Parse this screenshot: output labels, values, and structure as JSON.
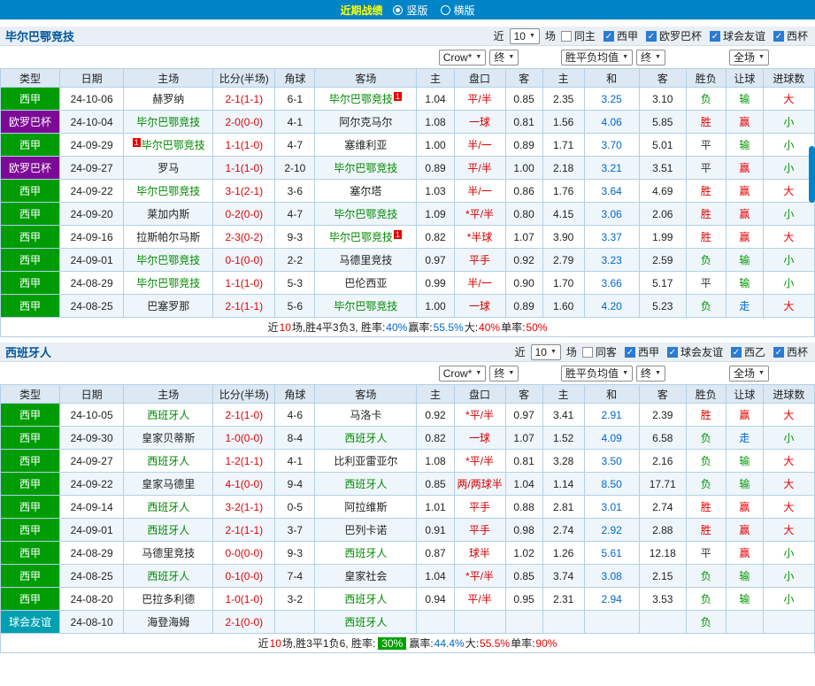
{
  "topbar": {
    "title": "近期战绩",
    "radios": [
      {
        "label": "竖版",
        "selected": true
      },
      {
        "label": "横版",
        "selected": false
      }
    ]
  },
  "sections": [
    {
      "team": "毕尔巴鄂竞技",
      "filter": {
        "near": "近",
        "count": "10",
        "unit": "场",
        "checkboxes": [
          {
            "label": "同主",
            "checked": false
          },
          {
            "label": "西甲",
            "checked": true
          },
          {
            "label": "欧罗巴杯",
            "checked": true
          },
          {
            "label": "球会友谊",
            "checked": true
          },
          {
            "label": "西杯",
            "checked": true
          }
        ]
      },
      "selects": {
        "bookmaker": "Crow*",
        "bookmaker_stage": "终",
        "europe_avg": "胜平负均值",
        "europe_stage": "终",
        "scope": "全场"
      },
      "columns": [
        "类型",
        "日期",
        "主场",
        "比分(半场)",
        "角球",
        "客场",
        "主",
        "盘口",
        "客",
        "主",
        "和",
        "客",
        "胜负",
        "让球",
        "进球数"
      ],
      "rows": [
        {
          "league": "西甲",
          "date": "24-10-06",
          "home": {
            "name": "赫罗纳",
            "focus": false,
            "card": ""
          },
          "score": "2-1(1-1)",
          "corner": "6-1",
          "away": {
            "name": "毕尔巴鄂竞技",
            "focus": true,
            "card": "1"
          },
          "asia": {
            "h": "1.04",
            "line": "平/半",
            "a": "0.85"
          },
          "eu": {
            "h": "2.35",
            "d": "3.25",
            "a": "3.10"
          },
          "res": {
            "wdl": "负",
            "ah": "输",
            "ou": "大"
          }
        },
        {
          "league": "欧罗巴杯",
          "date": "24-10-04",
          "home": {
            "name": "毕尔巴鄂竞技",
            "focus": true,
            "card": ""
          },
          "score": "2-0(0-0)",
          "corner": "4-1",
          "away": {
            "name": "阿尔克马尔",
            "focus": false,
            "card": ""
          },
          "asia": {
            "h": "1.08",
            "line": "一球",
            "a": "0.81"
          },
          "eu": {
            "h": "1.56",
            "d": "4.06",
            "a": "5.85"
          },
          "res": {
            "wdl": "胜",
            "ah": "赢",
            "ou": "小"
          }
        },
        {
          "league": "西甲",
          "date": "24-09-29",
          "home": {
            "name": "毕尔巴鄂竞技",
            "focus": true,
            "card": "1"
          },
          "score": "1-1(1-0)",
          "corner": "4-7",
          "away": {
            "name": "塞维利亚",
            "focus": false,
            "card": ""
          },
          "asia": {
            "h": "1.00",
            "line": "半/一",
            "a": "0.89"
          },
          "eu": {
            "h": "1.71",
            "d": "3.70",
            "a": "5.01"
          },
          "res": {
            "wdl": "平",
            "ah": "输",
            "ou": "小"
          }
        },
        {
          "league": "欧罗巴杯",
          "date": "24-09-27",
          "home": {
            "name": "罗马",
            "focus": false,
            "card": ""
          },
          "score": "1-1(1-0)",
          "corner": "2-10",
          "away": {
            "name": "毕尔巴鄂竞技",
            "focus": true,
            "card": ""
          },
          "asia": {
            "h": "0.89",
            "line": "平/半",
            "a": "1.00"
          },
          "eu": {
            "h": "2.18",
            "d": "3.21",
            "a": "3.51"
          },
          "res": {
            "wdl": "平",
            "ah": "赢",
            "ou": "小"
          }
        },
        {
          "league": "西甲",
          "date": "24-09-22",
          "home": {
            "name": "毕尔巴鄂竞技",
            "focus": true,
            "card": ""
          },
          "score": "3-1(2-1)",
          "corner": "3-6",
          "away": {
            "name": "塞尔塔",
            "focus": false,
            "card": ""
          },
          "asia": {
            "h": "1.03",
            "line": "半/一",
            "a": "0.86"
          },
          "eu": {
            "h": "1.76",
            "d": "3.64",
            "a": "4.69"
          },
          "res": {
            "wdl": "胜",
            "ah": "赢",
            "ou": "大"
          }
        },
        {
          "league": "西甲",
          "date": "24-09-20",
          "home": {
            "name": "莱加内斯",
            "focus": false,
            "card": ""
          },
          "score": "0-2(0-0)",
          "corner": "4-7",
          "away": {
            "name": "毕尔巴鄂竞技",
            "focus": true,
            "card": ""
          },
          "asia": {
            "h": "1.09",
            "line": "*平/半",
            "a": "0.80"
          },
          "eu": {
            "h": "4.15",
            "d": "3.06",
            "a": "2.06"
          },
          "res": {
            "wdl": "胜",
            "ah": "赢",
            "ou": "小"
          }
        },
        {
          "league": "西甲",
          "date": "24-09-16",
          "home": {
            "name": "拉斯帕尔马斯",
            "focus": false,
            "card": ""
          },
          "score": "2-3(0-2)",
          "corner": "9-3",
          "away": {
            "name": "毕尔巴鄂竞技",
            "focus": true,
            "card": "1"
          },
          "asia": {
            "h": "0.82",
            "line": "*半球",
            "a": "1.07"
          },
          "eu": {
            "h": "3.90",
            "d": "3.37",
            "a": "1.99"
          },
          "res": {
            "wdl": "胜",
            "ah": "赢",
            "ou": "大"
          }
        },
        {
          "league": "西甲",
          "date": "24-09-01",
          "home": {
            "name": "毕尔巴鄂竞技",
            "focus": true,
            "card": ""
          },
          "score": "0-1(0-0)",
          "corner": "2-2",
          "away": {
            "name": "马德里竞技",
            "focus": false,
            "card": ""
          },
          "asia": {
            "h": "0.97",
            "line": "平手",
            "a": "0.92"
          },
          "eu": {
            "h": "2.79",
            "d": "3.23",
            "a": "2.59"
          },
          "res": {
            "wdl": "负",
            "ah": "输",
            "ou": "小"
          }
        },
        {
          "league": "西甲",
          "date": "24-08-29",
          "home": {
            "name": "毕尔巴鄂竞技",
            "focus": true,
            "card": ""
          },
          "score": "1-1(1-0)",
          "corner": "5-3",
          "away": {
            "name": "巴伦西亚",
            "focus": false,
            "card": ""
          },
          "asia": {
            "h": "0.99",
            "line": "半/一",
            "a": "0.90"
          },
          "eu": {
            "h": "1.70",
            "d": "3.66",
            "a": "5.17"
          },
          "res": {
            "wdl": "平",
            "ah": "输",
            "ou": "小"
          }
        },
        {
          "league": "西甲",
          "date": "24-08-25",
          "home": {
            "name": "巴塞罗那",
            "focus": false,
            "card": ""
          },
          "score": "2-1(1-1)",
          "corner": "5-6",
          "away": {
            "name": "毕尔巴鄂竞技",
            "focus": true,
            "card": ""
          },
          "asia": {
            "h": "1.00",
            "line": "一球",
            "a": "0.89"
          },
          "eu": {
            "h": "1.60",
            "d": "4.20",
            "a": "5.23"
          },
          "res": {
            "wdl": "负",
            "ah": "走",
            "ou": "大"
          }
        }
      ],
      "summary": [
        {
          "t": "近",
          "c": "k"
        },
        {
          "t": "10",
          "c": "r"
        },
        {
          "t": "场,胜4平3负3, 胜率:",
          "c": "k"
        },
        {
          "t": "40%",
          "c": "b"
        },
        {
          "t": " 赢率:",
          "c": "k"
        },
        {
          "t": "55.5%",
          "c": "b"
        },
        {
          "t": " 大:",
          "c": "k"
        },
        {
          "t": "40%",
          "c": "r"
        },
        {
          "t": " 单率:",
          "c": "k"
        },
        {
          "t": "50%",
          "c": "r"
        }
      ]
    },
    {
      "team": "西班牙人",
      "filter": {
        "near": "近",
        "count": "10",
        "unit": "场",
        "checkboxes": [
          {
            "label": "同客",
            "checked": false
          },
          {
            "label": "西甲",
            "checked": true
          },
          {
            "label": "球会友谊",
            "checked": true
          },
          {
            "label": "西乙",
            "checked": true
          },
          {
            "label": "西杯",
            "checked": true
          }
        ]
      },
      "selects": {
        "bookmaker": "Crow*",
        "bookmaker_stage": "终",
        "europe_avg": "胜平负均值",
        "europe_stage": "终",
        "scope": "全场"
      },
      "columns": [
        "类型",
        "日期",
        "主场",
        "比分(半场)",
        "角球",
        "客场",
        "主",
        "盘口",
        "客",
        "主",
        "和",
        "客",
        "胜负",
        "让球",
        "进球数"
      ],
      "rows": [
        {
          "league": "西甲",
          "date": "24-10-05",
          "home": {
            "name": "西班牙人",
            "focus": true,
            "card": ""
          },
          "score": "2-1(1-0)",
          "corner": "4-6",
          "away": {
            "name": "马洛卡",
            "focus": false,
            "card": ""
          },
          "asia": {
            "h": "0.92",
            "line": "*平/半",
            "a": "0.97"
          },
          "eu": {
            "h": "3.41",
            "d": "2.91",
            "a": "2.39"
          },
          "res": {
            "wdl": "胜",
            "ah": "赢",
            "ou": "大"
          }
        },
        {
          "league": "西甲",
          "date": "24-09-30",
          "home": {
            "name": "皇家贝蒂斯",
            "focus": false,
            "card": ""
          },
          "score": "1-0(0-0)",
          "corner": "8-4",
          "away": {
            "name": "西班牙人",
            "focus": true,
            "card": ""
          },
          "asia": {
            "h": "0.82",
            "line": "一球",
            "a": "1.07"
          },
          "eu": {
            "h": "1.52",
            "d": "4.09",
            "a": "6.58"
          },
          "res": {
            "wdl": "负",
            "ah": "走",
            "ou": "小"
          }
        },
        {
          "league": "西甲",
          "date": "24-09-27",
          "home": {
            "name": "西班牙人",
            "focus": true,
            "card": ""
          },
          "score": "1-2(1-1)",
          "corner": "4-1",
          "away": {
            "name": "比利亚雷亚尔",
            "focus": false,
            "card": ""
          },
          "asia": {
            "h": "1.08",
            "line": "*平/半",
            "a": "0.81"
          },
          "eu": {
            "h": "3.28",
            "d": "3.50",
            "a": "2.16"
          },
          "res": {
            "wdl": "负",
            "ah": "输",
            "ou": "大"
          }
        },
        {
          "league": "西甲",
          "date": "24-09-22",
          "home": {
            "name": "皇家马德里",
            "focus": false,
            "card": ""
          },
          "score": "4-1(0-0)",
          "corner": "9-4",
          "away": {
            "name": "西班牙人",
            "focus": true,
            "card": ""
          },
          "asia": {
            "h": "0.85",
            "line": "两/两球半",
            "a": "1.04"
          },
          "eu": {
            "h": "1.14",
            "d": "8.50",
            "a": "17.71"
          },
          "res": {
            "wdl": "负",
            "ah": "输",
            "ou": "大"
          }
        },
        {
          "league": "西甲",
          "date": "24-09-14",
          "home": {
            "name": "西班牙人",
            "focus": true,
            "card": ""
          },
          "score": "3-2(1-1)",
          "corner": "0-5",
          "away": {
            "name": "阿拉维斯",
            "focus": false,
            "card": ""
          },
          "asia": {
            "h": "1.01",
            "line": "平手",
            "a": "0.88"
          },
          "eu": {
            "h": "2.81",
            "d": "3.01",
            "a": "2.74"
          },
          "res": {
            "wdl": "胜",
            "ah": "赢",
            "ou": "大"
          }
        },
        {
          "league": "西甲",
          "date": "24-09-01",
          "home": {
            "name": "西班牙人",
            "focus": true,
            "card": ""
          },
          "score": "2-1(1-1)",
          "corner": "3-7",
          "away": {
            "name": "巴列卡诺",
            "focus": false,
            "card": ""
          },
          "asia": {
            "h": "0.91",
            "line": "平手",
            "a": "0.98"
          },
          "eu": {
            "h": "2.74",
            "d": "2.92",
            "a": "2.88"
          },
          "res": {
            "wdl": "胜",
            "ah": "赢",
            "ou": "大"
          }
        },
        {
          "league": "西甲",
          "date": "24-08-29",
          "home": {
            "name": "马德里竞技",
            "focus": false,
            "card": ""
          },
          "score": "0-0(0-0)",
          "corner": "9-3",
          "away": {
            "name": "西班牙人",
            "focus": true,
            "card": ""
          },
          "asia": {
            "h": "0.87",
            "line": "球半",
            "a": "1.02"
          },
          "eu": {
            "h": "1.26",
            "d": "5.61",
            "a": "12.18"
          },
          "res": {
            "wdl": "平",
            "ah": "赢",
            "ou": "小"
          }
        },
        {
          "league": "西甲",
          "date": "24-08-25",
          "home": {
            "name": "西班牙人",
            "focus": true,
            "card": ""
          },
          "score": "0-1(0-0)",
          "corner": "7-4",
          "away": {
            "name": "皇家社会",
            "focus": false,
            "card": ""
          },
          "asia": {
            "h": "1.04",
            "line": "*平/半",
            "a": "0.85"
          },
          "eu": {
            "h": "3.74",
            "d": "3.08",
            "a": "2.15"
          },
          "res": {
            "wdl": "负",
            "ah": "输",
            "ou": "小"
          }
        },
        {
          "league": "西甲",
          "date": "24-08-20",
          "home": {
            "name": "巴拉多利德",
            "focus": false,
            "card": ""
          },
          "score": "1-0(1-0)",
          "corner": "3-2",
          "away": {
            "name": "西班牙人",
            "focus": true,
            "card": ""
          },
          "asia": {
            "h": "0.94",
            "line": "平/半",
            "a": "0.95"
          },
          "eu": {
            "h": "2.31",
            "d": "2.94",
            "a": "3.53"
          },
          "res": {
            "wdl": "负",
            "ah": "输",
            "ou": "小"
          }
        },
        {
          "league": "球会友谊",
          "date": "24-08-10",
          "home": {
            "name": "海登海姆",
            "focus": false,
            "card": ""
          },
          "score": "2-1(0-0)",
          "corner": "",
          "away": {
            "name": "西班牙人",
            "focus": true,
            "card": ""
          },
          "asia": {
            "h": "",
            "line": "",
            "a": ""
          },
          "eu": {
            "h": "",
            "d": "",
            "a": ""
          },
          "res": {
            "wdl": "负",
            "ah": "",
            "ou": ""
          }
        }
      ],
      "summary": [
        {
          "t": "近",
          "c": "k"
        },
        {
          "t": "10",
          "c": "r"
        },
        {
          "t": "场,胜3平1负6, 胜率: ",
          "c": "k"
        },
        {
          "t": "30%",
          "c": "box"
        },
        {
          "t": " 赢率:",
          "c": "k"
        },
        {
          "t": "44.4%",
          "c": "b"
        },
        {
          "t": " 大:",
          "c": "k"
        },
        {
          "t": "55.5%",
          "c": "r"
        },
        {
          "t": " 单率:",
          "c": "k"
        },
        {
          "t": "90%",
          "c": "r"
        }
      ]
    }
  ]
}
